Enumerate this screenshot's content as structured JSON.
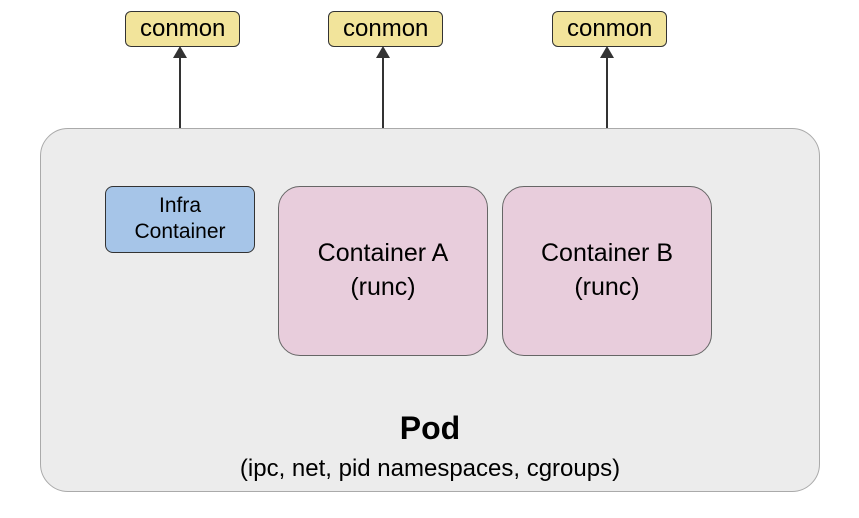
{
  "conmon": {
    "label": "conmon"
  },
  "infra": {
    "line1": "Infra",
    "line2": "Container"
  },
  "containerA": {
    "line1": "Container A",
    "line2": "(runc)"
  },
  "containerB": {
    "line1": "Container B",
    "line2": "(runc)"
  },
  "pod": {
    "title": "Pod",
    "subtitle": "(ipc, net,  pid namespaces, cgroups)"
  },
  "chart_data": {
    "type": "diagram",
    "title": "Pod",
    "subtitle": "(ipc, net, pid namespaces, cgroups)",
    "nodes": [
      {
        "id": "conmon1",
        "label": "conmon",
        "type": "monitor"
      },
      {
        "id": "conmon2",
        "label": "conmon",
        "type": "monitor"
      },
      {
        "id": "conmon3",
        "label": "conmon",
        "type": "monitor"
      },
      {
        "id": "infra",
        "label": "Infra Container",
        "type": "container",
        "parent": "pod"
      },
      {
        "id": "containerA",
        "label": "Container A (runc)",
        "type": "container",
        "parent": "pod"
      },
      {
        "id": "containerB",
        "label": "Container B (runc)",
        "type": "container",
        "parent": "pod"
      },
      {
        "id": "pod",
        "label": "Pod",
        "type": "pod",
        "shared": [
          "ipc",
          "net",
          "pid namespaces",
          "cgroups"
        ]
      }
    ],
    "edges": [
      {
        "from": "conmon1",
        "to": "infra",
        "bidirectional": true
      },
      {
        "from": "conmon2",
        "to": "containerA",
        "bidirectional": true
      },
      {
        "from": "conmon3",
        "to": "containerB",
        "bidirectional": true
      }
    ]
  }
}
